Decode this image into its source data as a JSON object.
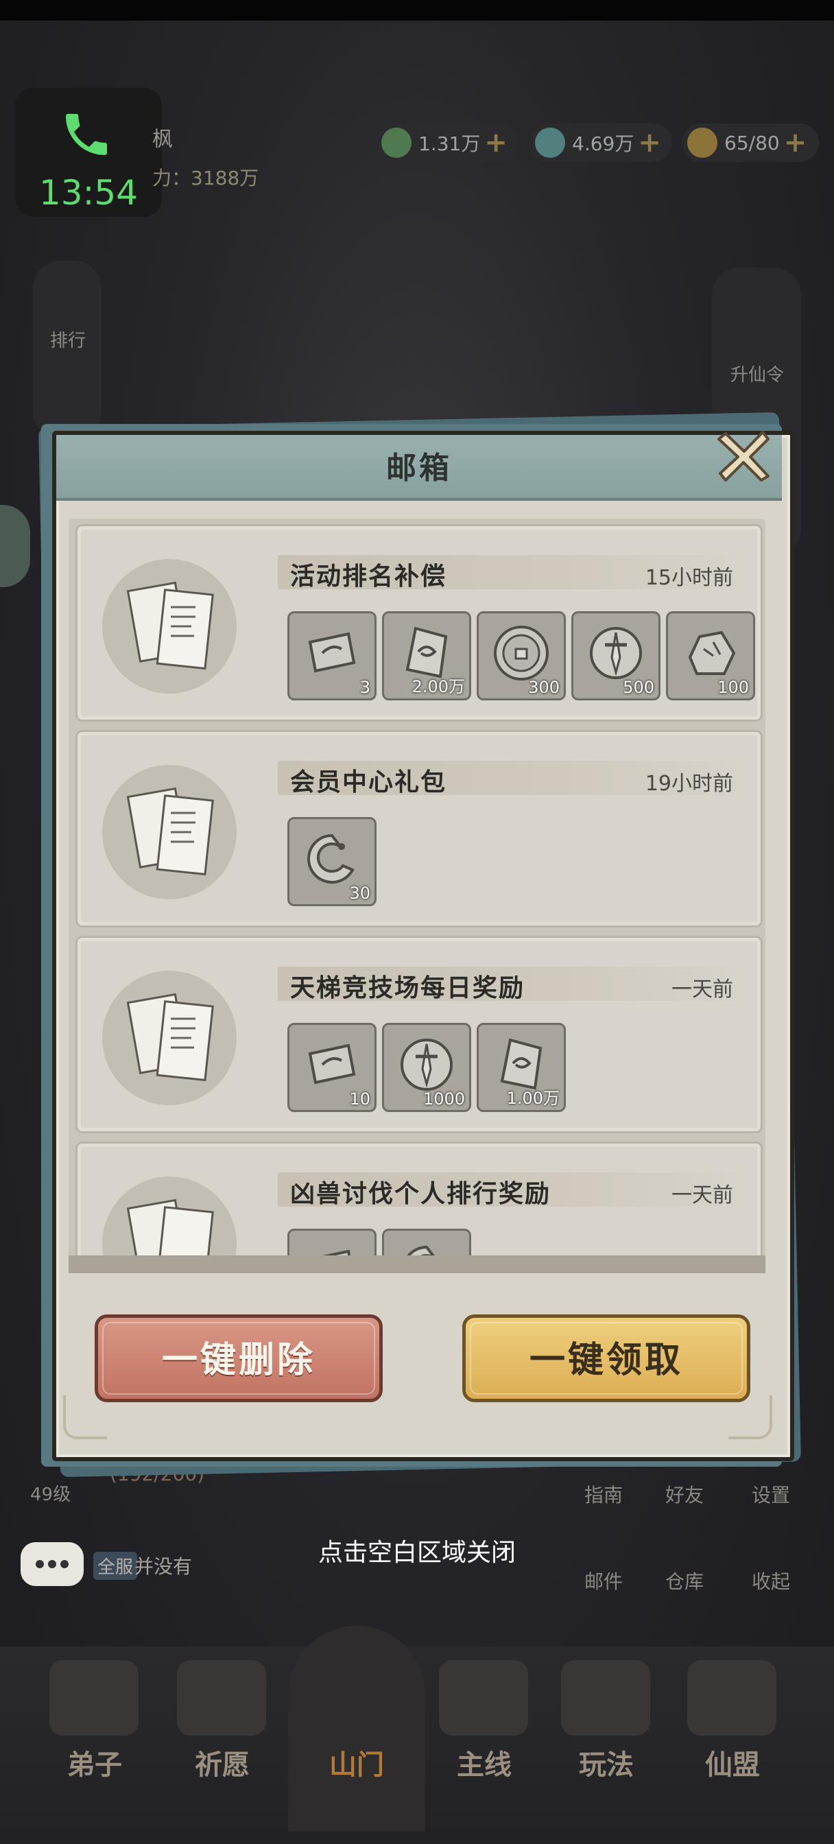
{
  "status_bar": {
    "call_time": "13:54"
  },
  "player": {
    "name_partial": "枫",
    "power_partial": "力：3188万"
  },
  "resources": [
    {
      "icon": "jade-coin-icon",
      "value": "1.31万",
      "color": "#6aa36a"
    },
    {
      "icon": "spirit-stone-icon",
      "value": "4.69万",
      "color": "#6ea6a8"
    },
    {
      "icon": "stamina-gourd-icon",
      "value": "65/80",
      "color": "#c8a24a"
    }
  ],
  "left_menu": {
    "rank": "排行"
  },
  "right_menu": {
    "ascend": "升仙令"
  },
  "mailbox": {
    "title": "邮箱",
    "mails": [
      {
        "title": "活动排名补偿",
        "time": "15小时前",
        "items": [
          {
            "icon": "scroll-talisman-icon",
            "qty": "3"
          },
          {
            "icon": "spirit-stone-icon",
            "qty": "2.00万"
          },
          {
            "icon": "coin-icon",
            "qty": "300"
          },
          {
            "icon": "sword-emblem-icon",
            "qty": "500"
          },
          {
            "icon": "ore-icon",
            "qty": "100"
          }
        ]
      },
      {
        "title": "会员中心礼包",
        "time": "19小时前",
        "items": [
          {
            "icon": "jade-dragon-icon",
            "qty": "30"
          }
        ]
      },
      {
        "title": "天梯竞技场每日奖励",
        "time": "一天前",
        "items": [
          {
            "icon": "scroll-talisman-icon",
            "qty": "10"
          },
          {
            "icon": "sword-emblem-icon",
            "qty": "1000"
          },
          {
            "icon": "spirit-stone-icon",
            "qty": "1.00万"
          }
        ]
      },
      {
        "title": "凶兽讨伐个人排行奖励",
        "time": "一天前",
        "items": [
          {
            "icon": "scroll-talisman-icon",
            "qty": ""
          },
          {
            "icon": "jade-dragon-icon",
            "qty": ""
          }
        ]
      }
    ],
    "delete_all": "一键删除",
    "claim_all": "一键领取"
  },
  "close_hint": "点击空白区域关闭",
  "chat": {
    "channel": "全服",
    "message": "并没有"
  },
  "player_level": "49级",
  "exp": "(192/200)",
  "right_panel": {
    "guide": "指南",
    "friends": "好友",
    "settings": "设置",
    "mail": "邮件",
    "storage": "仓库",
    "collapse": "收起"
  },
  "bottom_nav": [
    {
      "label": "弟子"
    },
    {
      "label": "祈愿"
    },
    {
      "label": "山门"
    },
    {
      "label": "主线"
    },
    {
      "label": "玩法"
    },
    {
      "label": "仙盟"
    }
  ],
  "colors": {
    "delete_btn": "#c97a68",
    "claim_btn": "#e6be66",
    "header": "#8fa7a5"
  }
}
